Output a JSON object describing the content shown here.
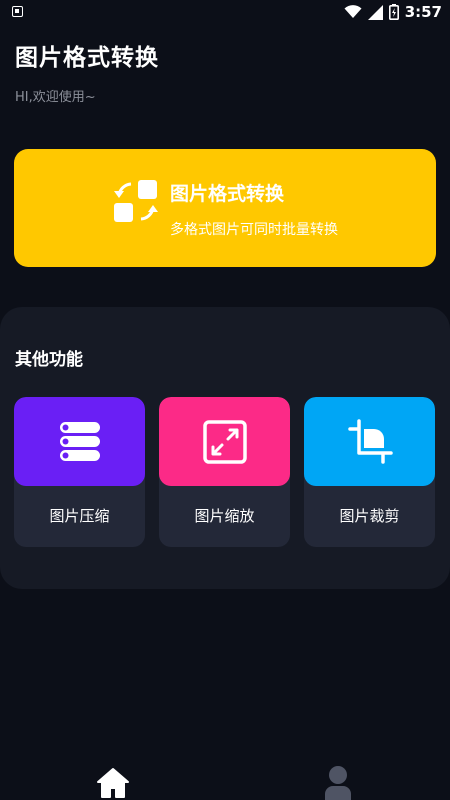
{
  "status_bar": {
    "time": "3:57",
    "icons": [
      "notification-icon",
      "wifi-icon",
      "signal-icon",
      "battery-icon"
    ]
  },
  "header": {
    "title": "图片格式转换",
    "welcome": "HI,欢迎使用~"
  },
  "hero": {
    "title": "图片格式转换",
    "subtitle": "多格式图片可同时批量转换",
    "icon": "format-convert-icon",
    "color": "#ffc800"
  },
  "other_functions": {
    "title": "其他功能",
    "items": [
      {
        "label": "图片压缩",
        "icon": "compress-icon",
        "color": "#6a1ff5"
      },
      {
        "label": "图片缩放",
        "icon": "resize-icon",
        "color": "#fc2a87"
      },
      {
        "label": "图片裁剪",
        "icon": "crop-icon",
        "color": "#00a6f5"
      }
    ]
  },
  "bottom_nav": {
    "items": [
      {
        "icon": "home-icon",
        "active": true
      },
      {
        "icon": "profile-icon",
        "active": false
      }
    ]
  }
}
